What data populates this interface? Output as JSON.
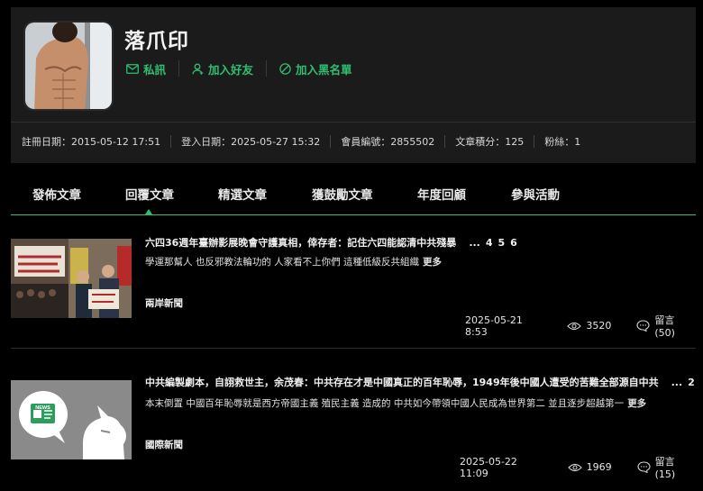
{
  "profile": {
    "username": "落爪印",
    "actions": [
      {
        "label": "私訊",
        "icon": "mail-icon"
      },
      {
        "label": "加入好友",
        "icon": "add-friend-icon"
      },
      {
        "label": "加入黑名單",
        "icon": "block-icon"
      }
    ],
    "stats": {
      "register": "註冊日期：2015-05-12 17:51",
      "login": "登入日期：2025-05-27 15:32",
      "member_no": "會員編號：2855502",
      "points": "文章積分：125",
      "fans": "粉絲：1"
    }
  },
  "tabs": [
    {
      "label": "發佈文章",
      "active": false
    },
    {
      "label": "回覆文章",
      "active": true
    },
    {
      "label": "精選文章",
      "active": false
    },
    {
      "label": "獲鼓勵文章",
      "active": false
    },
    {
      "label": "年度回顧",
      "active": false
    },
    {
      "label": "參與活動",
      "active": false
    }
  ],
  "articles": [
    {
      "title": "六四36週年臺辦影展晚會守護真相，倖存者：記住六四能認清中共殘暴",
      "ellipsis": "...",
      "pages": [
        "4",
        "5",
        "6"
      ],
      "excerpt": "學運那幫人 也反邪教法輪功的 人家看不上你們 這種低級反共組織",
      "more": "更多",
      "category": "兩岸新聞",
      "date": "2025-05-21 8:53",
      "views": "3520",
      "comments": "留言 (50)"
    },
    {
      "title": "中共編製劇本，自詡救世主，余茂春：中共存在才是中國真正的百年恥辱，1949年後中國人遭受的苦難全部源自中共",
      "ellipsis": "...",
      "pages": [
        "2"
      ],
      "excerpt": "本末倒置 中國百年恥辱就是西方帝國主義 殖民主義 造成的 中共如今帶領中國人民成為世界第二 並且逐步超越第一",
      "more": "更多",
      "category": "國際新聞",
      "date": "2025-05-22 11:09",
      "views": "1969",
      "comments": "留言 (15)"
    }
  ],
  "colors": {
    "accent": "#2fbf71",
    "panel": "#1b1b1b",
    "background": "#000000"
  }
}
